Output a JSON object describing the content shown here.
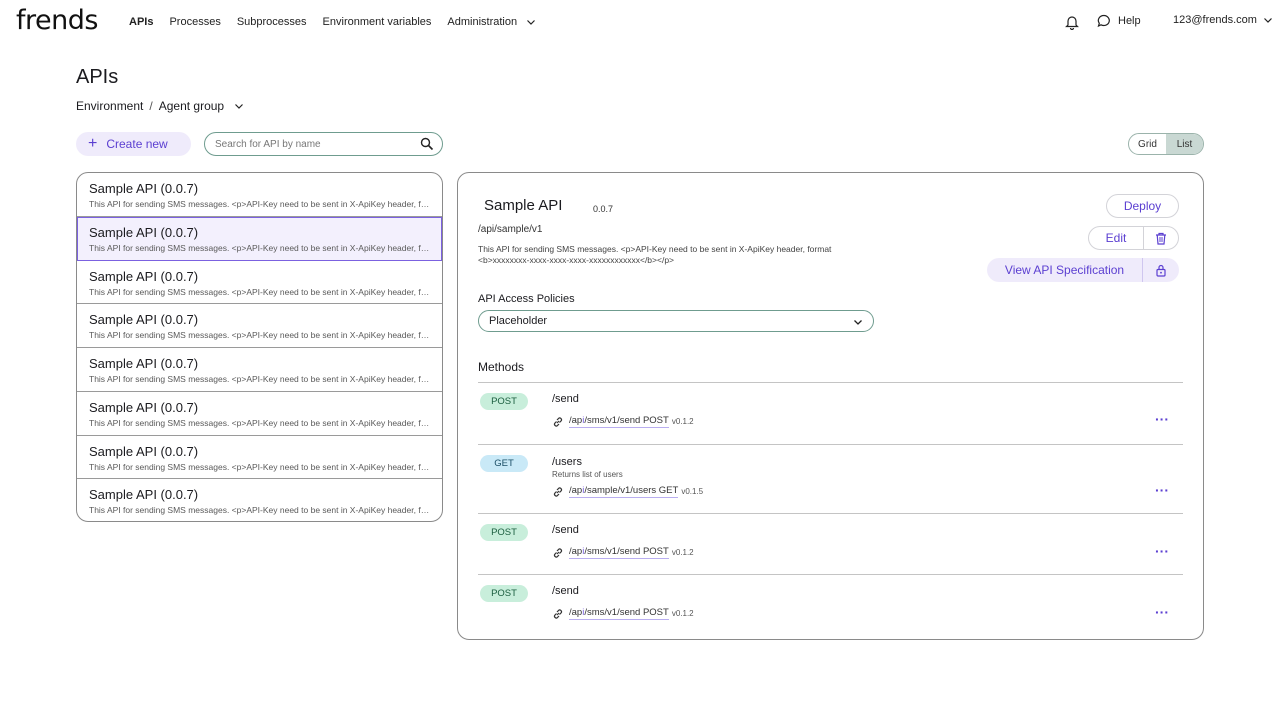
{
  "nav": {
    "logo": "frends",
    "items": [
      {
        "label": "APIs",
        "active": true
      },
      {
        "label": "Processes"
      },
      {
        "label": "Subprocesses"
      },
      {
        "label": "Environment variables"
      },
      {
        "label": "Administration"
      }
    ],
    "help": "Help",
    "user": "123@frends.com"
  },
  "page": {
    "title": "APIs",
    "breadcrumb": {
      "environment": "Environment",
      "separator": "/",
      "agent_group": "Agent group"
    }
  },
  "toolbar": {
    "create_label": "Create new",
    "search_placeholder": "Search for API by name",
    "view_grid": "Grid",
    "view_list": "List",
    "active_view": "List"
  },
  "api_list": [
    {
      "name": "Sample API (0.0.7)",
      "desc": "This API for sending SMS messages. <p>API-Key need to be sent in X-ApiKey header, format"
    },
    {
      "name": "Sample API (0.0.7)",
      "desc": "This API for sending SMS messages. <p>API-Key need to be sent in X-ApiKey header, format",
      "selected": true
    },
    {
      "name": "Sample API (0.0.7)",
      "desc": "This API for sending SMS messages. <p>API-Key need to be sent in X-ApiKey header, format"
    },
    {
      "name": "Sample API (0.0.7)",
      "desc": "This API for sending SMS messages. <p>API-Key need to be sent in X-ApiKey header, format"
    },
    {
      "name": "Sample API (0.0.7)",
      "desc": "This API for sending SMS messages. <p>API-Key need to be sent in X-ApiKey header, format"
    },
    {
      "name": "Sample API (0.0.7)",
      "desc": "This API for sending SMS messages. <p>API-Key need to be sent in X-ApiKey header, format"
    },
    {
      "name": "Sample API (0.0.7)",
      "desc": "This API for sending SMS messages. <p>API-Key need to be sent in X-ApiKey header, format"
    },
    {
      "name": "Sample API (0.0.7)",
      "desc": "This API for sending SMS messages. <p>API-Key need to be sent in X-ApiKey header, format"
    }
  ],
  "detail": {
    "title": "Sample API",
    "version": "0.0.7",
    "path": "/api/sample/v1",
    "description": "This API for sending SMS messages. <p>API-Key need to be sent in X-ApiKey header, format <b>xxxxxxxx-xxxx-xxxx-xxxx-xxxxxxxxxxxx</b></p>",
    "deploy_label": "Deploy",
    "edit_label": "Edit",
    "spec_label": "View API Specification",
    "policies_label": "API Access Policies",
    "policies_value": "Placeholder",
    "methods_title": "Methods",
    "methods": [
      {
        "verb": "POST",
        "path": "/send",
        "sub": "",
        "link_pre": "/ap",
        "link_i": "i",
        "link_post": "/sms/v1/send POST",
        "version": "v0.1.2"
      },
      {
        "verb": "GET",
        "path": "/users",
        "sub": "Returns list of users",
        "link_pre": "/ap",
        "link_i": "i",
        "link_post": "/sample/v1/users GET",
        "version": "v0.1.5"
      },
      {
        "verb": "POST",
        "path": "/send",
        "sub": "",
        "link_pre": "/ap",
        "link_i": "i",
        "link_post": "/sms/v1/send POST",
        "version": "v0.1.2"
      },
      {
        "verb": "POST",
        "path": "/send",
        "sub": "",
        "link_pre": "/ap",
        "link_i": "i",
        "link_post": "/sms/v1/send POST",
        "version": "v0.1.2"
      }
    ],
    "more_label": "···"
  },
  "colors": {
    "accent": "#5b3fd1",
    "accent_bg": "#efebfb",
    "post_badge": "#c8eedb",
    "get_badge": "#c9e9f7"
  }
}
